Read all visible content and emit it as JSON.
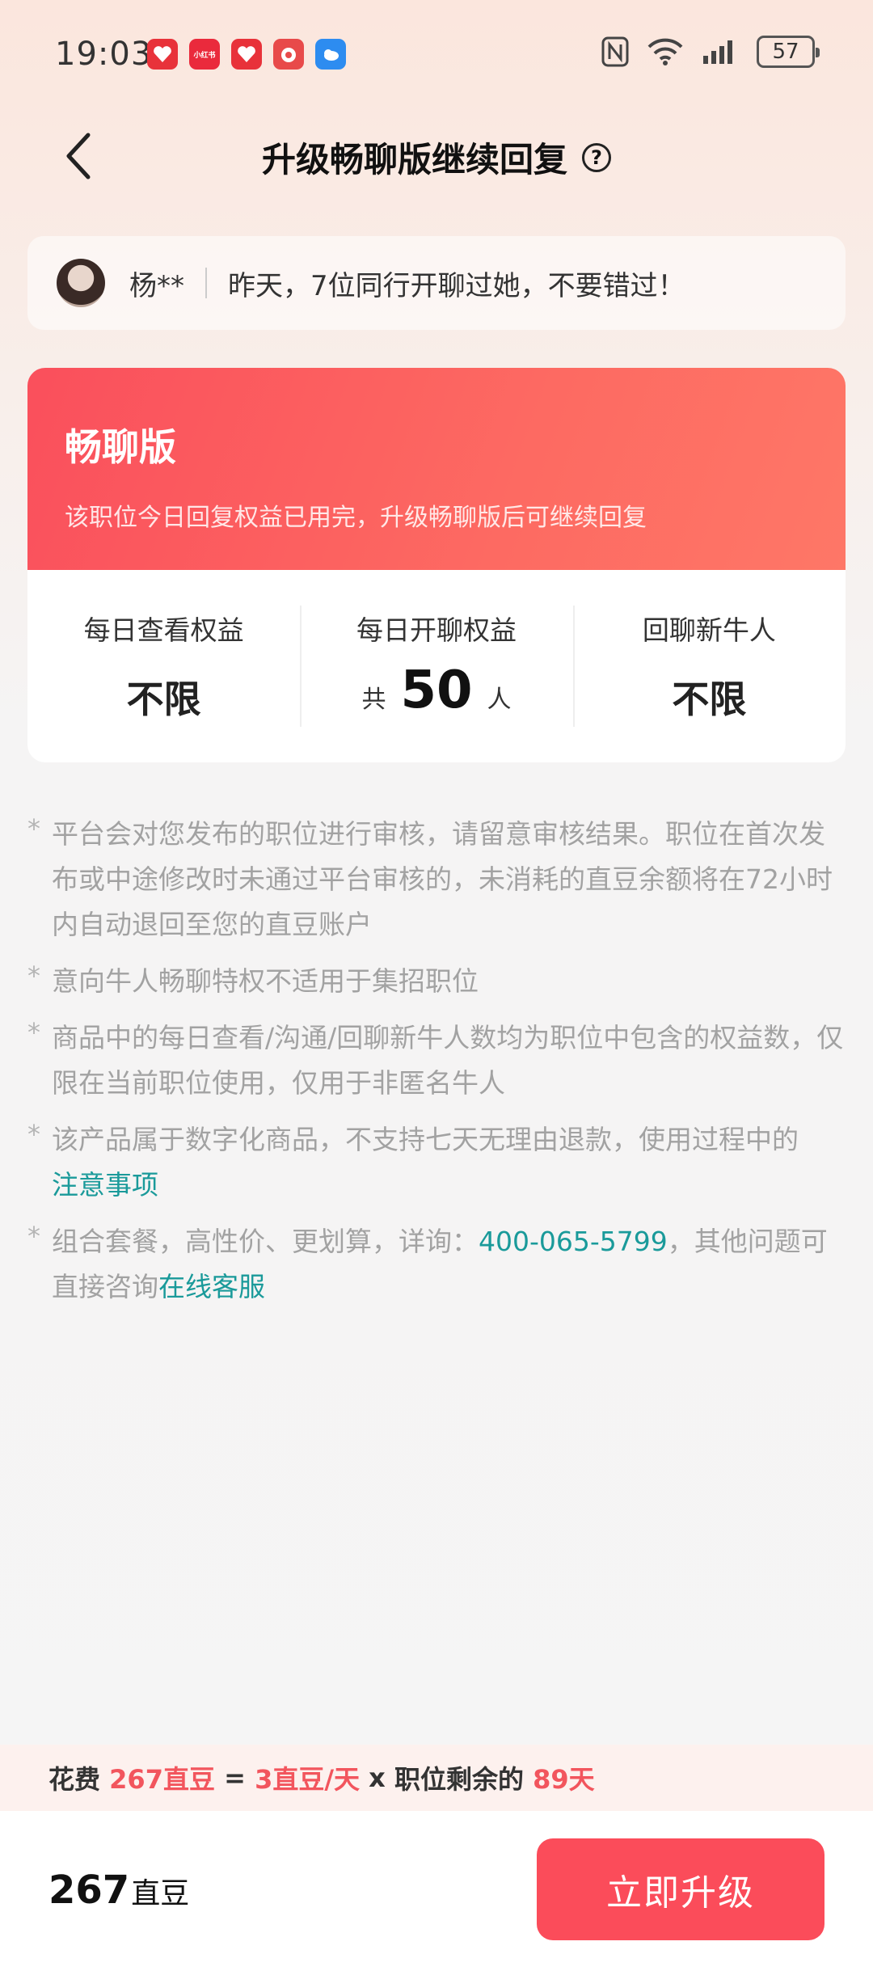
{
  "status_bar": {
    "time": "19:03",
    "app_icons": [
      {
        "name": "app-1-icon",
        "color": "#e8323a",
        "label": ""
      },
      {
        "name": "xiaohongshu-icon",
        "color": "#ea2a3c",
        "label": "小红书"
      },
      {
        "name": "app-3-icon",
        "color": "#e8323a",
        "label": ""
      },
      {
        "name": "app-4-icon",
        "color": "#e84a4a",
        "label": ""
      },
      {
        "name": "weather-icon",
        "color": "#2d8cf0",
        "label": ""
      }
    ],
    "battery": "57"
  },
  "header": {
    "title": "升级畅聊版继续回复",
    "help": "?"
  },
  "notice": {
    "name": "杨**",
    "text": "昨天，7位同行开聊过她，不要错过！"
  },
  "plan": {
    "name": "畅聊版",
    "desc": "该职位今日回复权益已用完，升级畅聊版后可继续回复",
    "stats": [
      {
        "label": "每日查看权益",
        "value": "不限"
      },
      {
        "label": "每日开聊权益",
        "prefix": "共",
        "value": "50",
        "suffix": "人"
      },
      {
        "label": "回聊新牛人",
        "value": "不限"
      }
    ]
  },
  "notes": {
    "n1": "平台会对您发布的职位进行审核，请留意审核结果。职位在首次发布或中途修改时未通过平台审核的，未消耗的直豆余额将在72小时内自动退回至您的直豆账户",
    "n2": "意向牛人畅聊特权不适用于集招职位",
    "n3": "商品中的每日查看/沟通/回聊新牛人数均为职位中包含的权益数，仅限在当前职位使用，仅用于非匿名牛人",
    "n4_text": "该产品属于数字化商品，不支持七天无理由退款，使用过程中的",
    "n4_link": "注意事项",
    "n5_text1": "组合套餐，高性价、更划算，详询：",
    "n5_phone": "400-065-5799",
    "n5_text2": "，其他问题可直接咨询",
    "n5_link": "在线客服"
  },
  "cost": {
    "prefix": "花费",
    "total": "267直豆",
    "eq": "=",
    "rate": "3直豆/天",
    "times": "x",
    "mid": "职位剩余的",
    "days": "89天"
  },
  "footer": {
    "price_num": "267",
    "price_unit": "直豆",
    "button": "立即升级"
  },
  "colors": {
    "accent": "#fb4c5a",
    "link": "#1a9a9a"
  }
}
